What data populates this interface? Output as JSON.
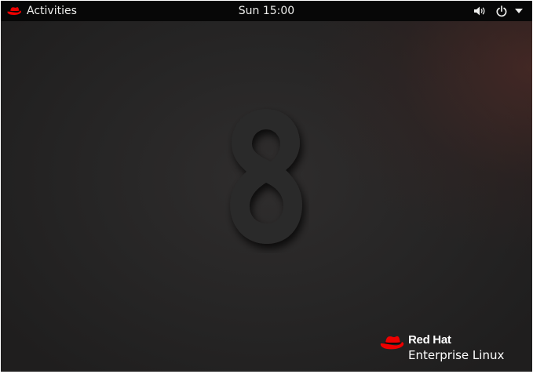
{
  "topbar": {
    "activities_label": "Activities",
    "clock": "Sun 15:00",
    "icons": [
      "redhat-logo-icon",
      "volume-icon",
      "power-icon",
      "chevron-down-icon"
    ]
  },
  "desktop": {
    "wallpaper_numeral": "8",
    "brand": {
      "name": "Red Hat",
      "product": "Enterprise Linux"
    }
  },
  "colors": {
    "topbar": "#070707",
    "desktop": "#2a2828",
    "redhat_red": "#ee0000",
    "text": "#eeeeec"
  }
}
